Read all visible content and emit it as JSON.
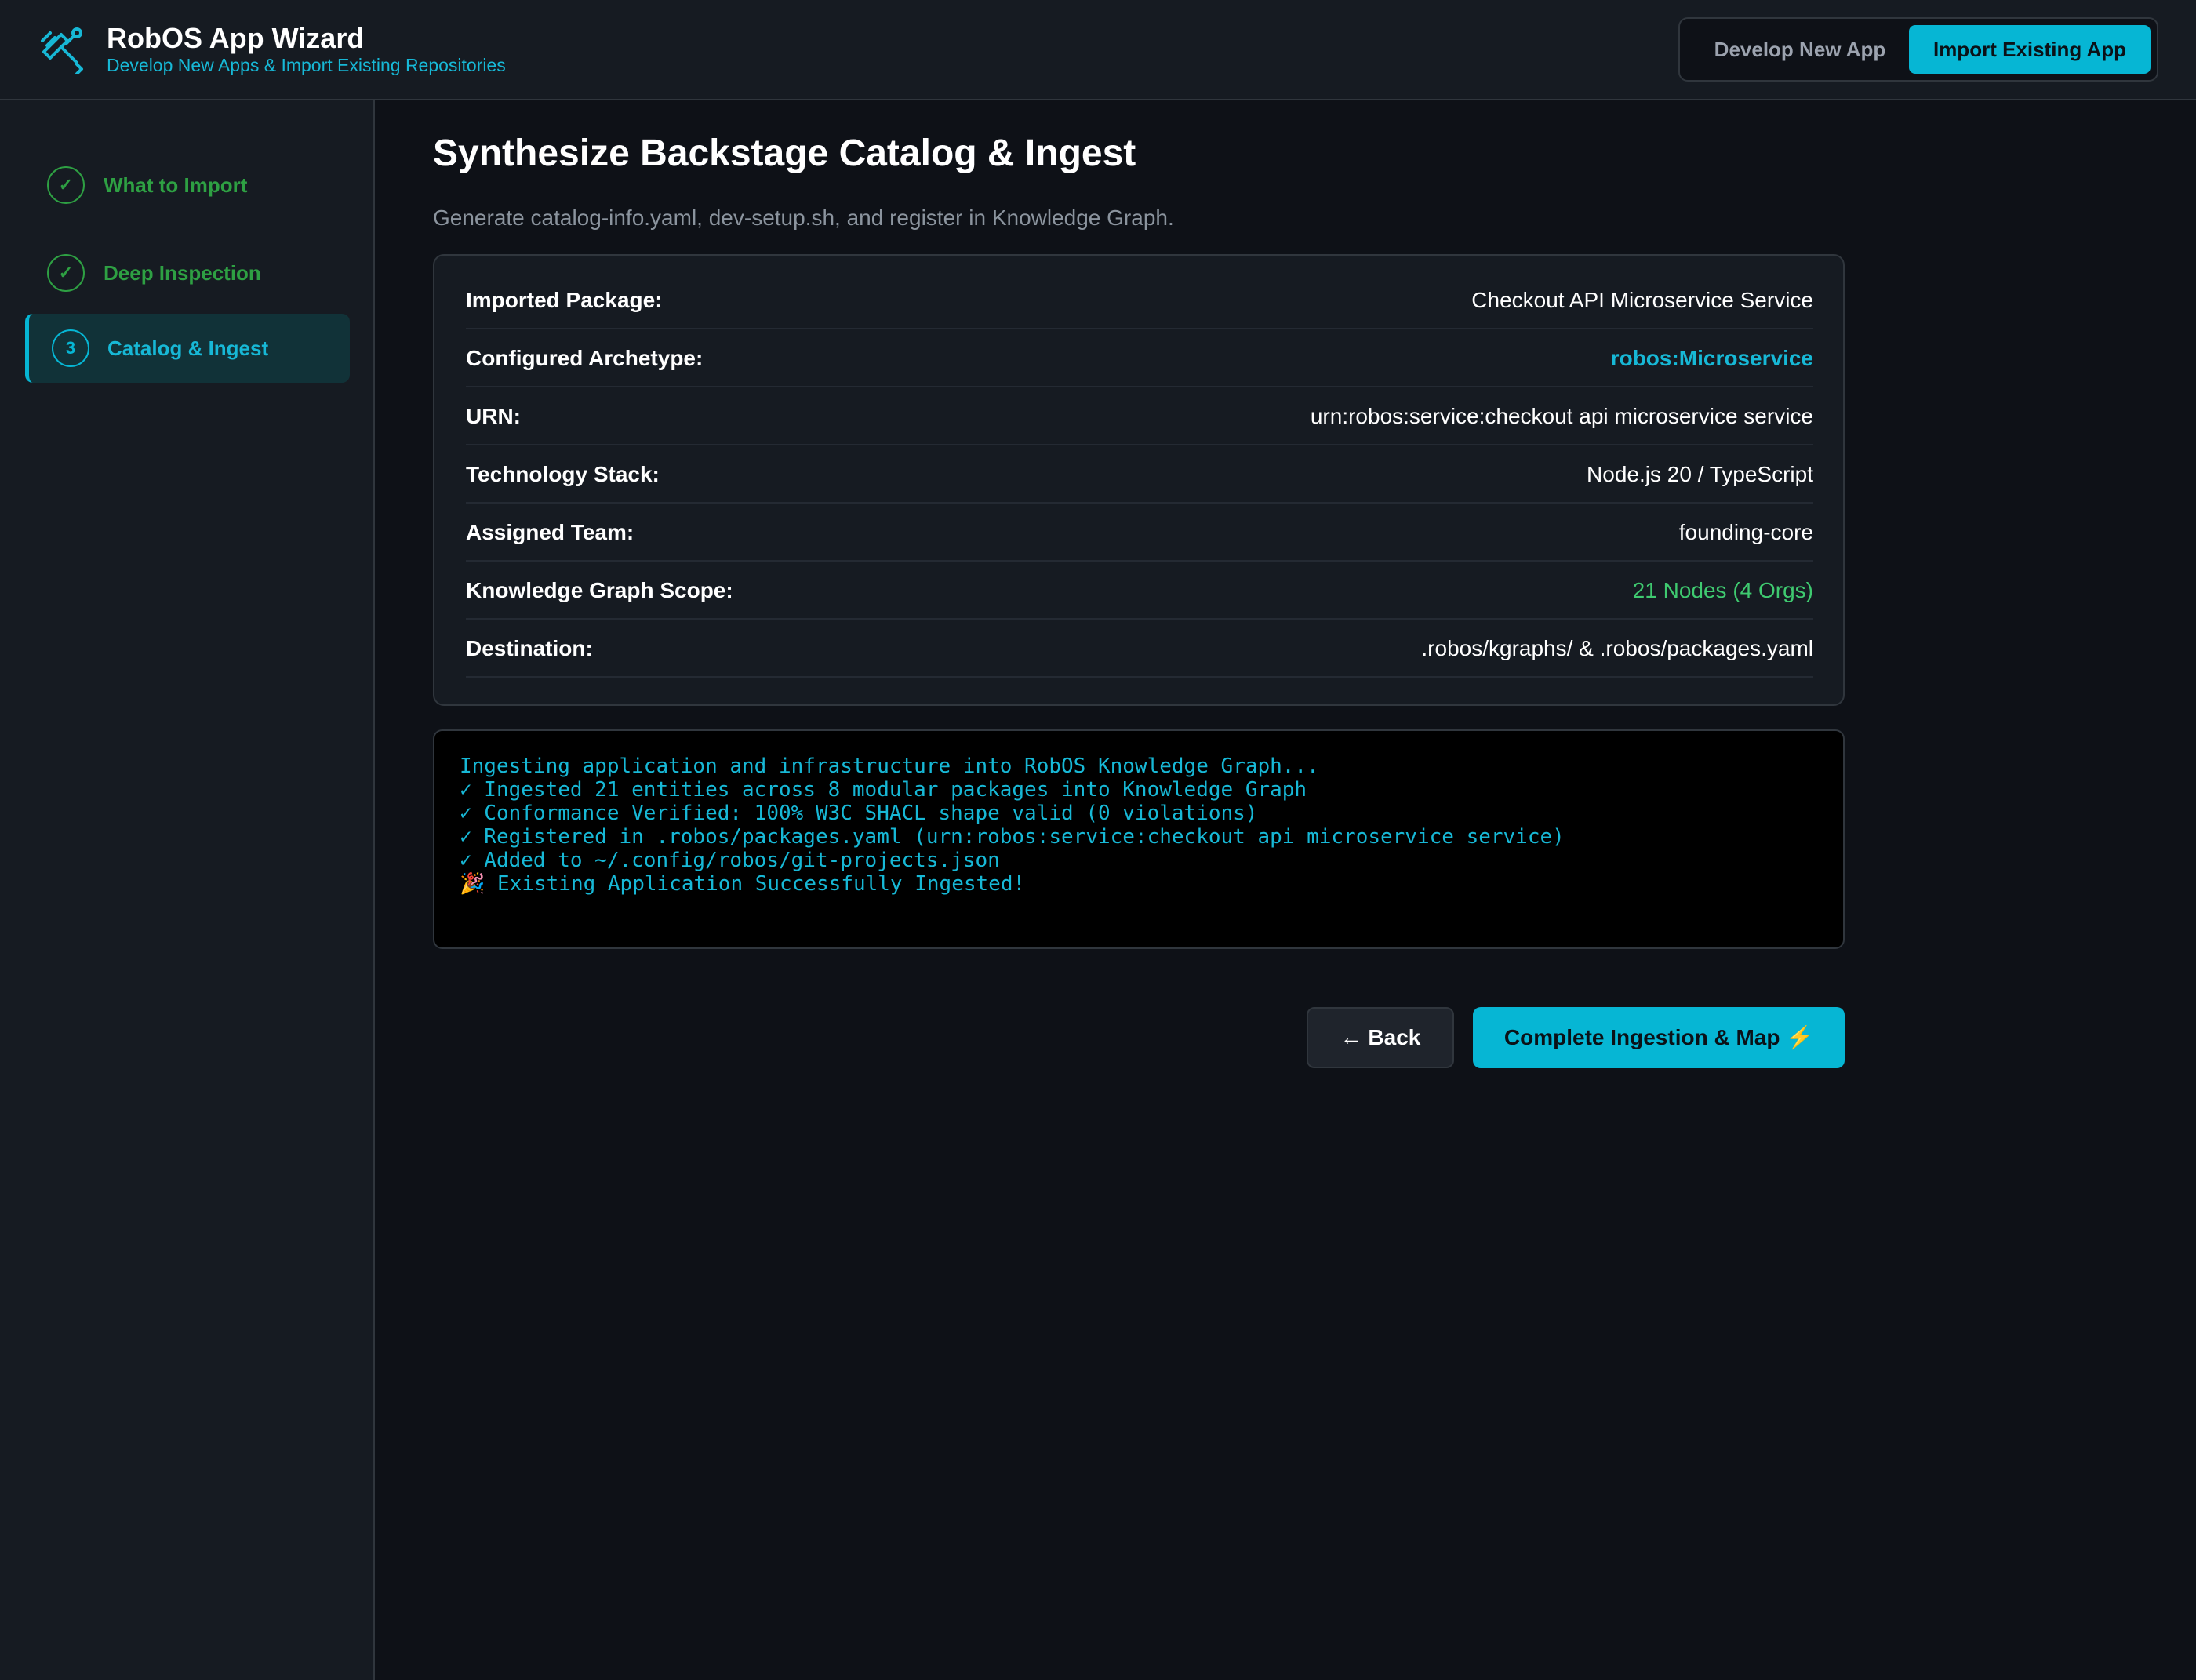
{
  "header": {
    "logo_icon": "tools-icon",
    "title": "RobOS App Wizard",
    "subtitle": "Develop New Apps & Import Existing Repositories",
    "mode_switch": {
      "develop_label": "Develop New App",
      "import_label": "Import Existing App",
      "selected": "Import Existing App"
    }
  },
  "sidebar": {
    "steps": [
      {
        "marker": "✓",
        "label": "What to Import",
        "state": "completed"
      },
      {
        "marker": "✓",
        "label": "Deep Inspection",
        "state": "completed"
      },
      {
        "marker": "3",
        "label": "Catalog & Ingest",
        "state": "active"
      }
    ]
  },
  "main": {
    "title": "Synthesize Backstage Catalog & Ingest",
    "description": "Generate catalog-info.yaml, dev-setup.sh, and register in Knowledge Graph.",
    "summary": [
      {
        "label": "Imported Package:",
        "value": "Checkout API Microservice Service"
      },
      {
        "label": "Configured Archetype:",
        "value": "robos:Microservice"
      },
      {
        "label": "URN:",
        "value": "urn:robos:service:checkout api microservice service"
      },
      {
        "label": "Technology Stack:",
        "value": "Node.js 20 / TypeScript"
      },
      {
        "label": "Assigned Team:",
        "value": "founding-core"
      },
      {
        "label": "Knowledge Graph Scope:",
        "value": "21 Nodes (4 Orgs)"
      },
      {
        "label": "Destination:",
        "value": ".robos/kgraphs/ & .robos/packages.yaml"
      }
    ],
    "console_lines": [
      "Ingesting application and infrastructure into RobOS Knowledge Graph...",
      "✓ Ingested 21 entities across 8 modular packages into Knowledge Graph",
      "✓ Conformance Verified: 100% W3C SHACL shape valid (0 violations)",
      "✓ Registered in .robos/packages.yaml (urn:robos:service:checkout api microservice service)",
      "✓ Added to ~/.config/robos/git-projects.json",
      "🎉 Existing Application Successfully Ingested!"
    ],
    "back_label": "← Back",
    "complete_label": "Complete Ingestion & Map ⚡"
  },
  "colors": {
    "accent": "#06b6d4",
    "success": "#2ea043",
    "background": "#0e1117",
    "panel": "#161b22"
  }
}
